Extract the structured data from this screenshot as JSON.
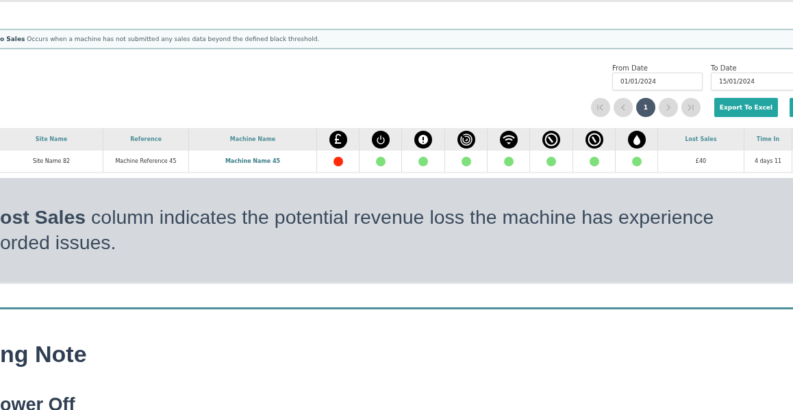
{
  "info_banner": {
    "text": "**o Sales** Occurs when a machine has not submitted any sales data beyond the defined black threshold."
  },
  "filters": [
    {
      "label": "From Date",
      "value": "01/01/2024"
    },
    {
      "label": "To Date",
      "value": "15/01/2024"
    }
  ],
  "pagination": {
    "nav": [
      {
        "kind": "first",
        "disabled": true
      },
      {
        "kind": "prev",
        "disabled": true
      },
      {
        "kind": "next",
        "disabled": true
      },
      {
        "kind": "last",
        "disabled": true
      }
    ],
    "pages": [
      {
        "label": "1",
        "selected": true
      }
    ]
  },
  "export_button": {
    "label": "Export To Excel"
  },
  "table": {
    "columns": [
      {
        "kind": "text",
        "label": "Site Name"
      },
      {
        "kind": "text",
        "label": "Reference"
      },
      {
        "kind": "text",
        "label": "Machine Name"
      },
      {
        "kind": "icon"
      },
      {
        "kind": "icon"
      },
      {
        "kind": "icon"
      },
      {
        "kind": "icon"
      },
      {
        "kind": "icon"
      },
      {
        "kind": "icon"
      },
      {
        "kind": "icon"
      },
      {
        "kind": "icon"
      },
      {
        "kind": "text",
        "label": "Lost Sales"
      },
      {
        "kind": "text",
        "label": "Time In"
      }
    ],
    "rows": [
      {
        "cells": [
          {
            "kind": "text",
            "text": "Site Name 82"
          },
          {
            "kind": "text",
            "text": "Machine Reference 45"
          },
          {
            "kind": "link",
            "text": "Machine Name 45"
          },
          {
            "kind": "status",
            "color": "#ff2a0a"
          },
          {
            "kind": "status",
            "color": "#7ee07a"
          },
          {
            "kind": "status",
            "color": "#7ee07a"
          },
          {
            "kind": "status",
            "color": "#7ee07a"
          },
          {
            "kind": "status",
            "color": "#7ee07a"
          },
          {
            "kind": "status",
            "color": "#7ee07a"
          },
          {
            "kind": "status",
            "color": "#7ee07a"
          },
          {
            "kind": "status",
            "color": "#7ee07a"
          },
          {
            "kind": "text",
            "text": "£40"
          },
          {
            "kind": "text",
            "text": "4 days 11"
          }
        ]
      }
    ]
  },
  "callout": {
    "lines": [
      "**ost Sales** column indicates the potential revenue loss the machine has experience",
      "orded issues."
    ]
  },
  "headings": [
    {
      "kind": "section",
      "text": "ng Note"
    },
    {
      "kind": "subsection",
      "text": "ower Off"
    }
  ]
}
